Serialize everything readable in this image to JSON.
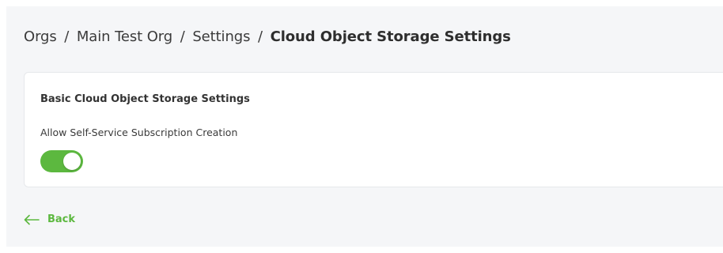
{
  "breadcrumb": {
    "items": [
      "Orgs",
      "Main Test Org",
      "Settings"
    ],
    "separator": "/",
    "current": "Cloud Object Storage Settings"
  },
  "card": {
    "title": "Basic Cloud Object Storage Settings",
    "setting_label": "Allow Self-Service Subscription Creation",
    "toggle_state": "on"
  },
  "back": {
    "label": "Back",
    "icon": "arrow-left-icon"
  },
  "colors": {
    "accent": "#5cb83f",
    "background": "#f5f6f8",
    "card": "#ffffff"
  }
}
